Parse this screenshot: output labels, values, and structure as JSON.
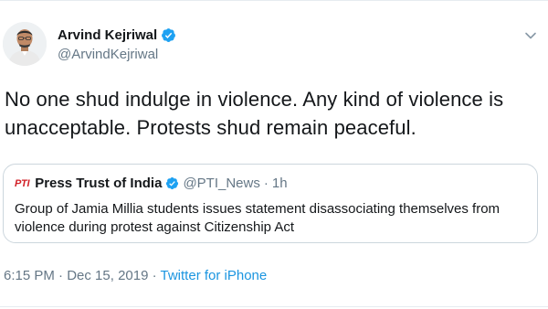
{
  "tweet": {
    "author": {
      "display_name": "Arvind Kejriwal",
      "handle": "@ArvindKejriwal",
      "verified": true
    },
    "text": "No one shud indulge in violence. Any kind of violence is unacceptable. Protests shud remain peaceful.",
    "quoted": {
      "logo_text": "PTI",
      "display_name": "Press Trust of India",
      "handle": "@PTI_News",
      "separator": "·",
      "time": "1h",
      "text": "Group of Jamia Millia students issues statement disassociating themselves from violence during protest against Citizenship Act"
    },
    "time": "6:15 PM",
    "separator1": " · ",
    "date": "Dec 15, 2019",
    "separator2": " · ",
    "source": "Twitter for iPhone"
  },
  "colors": {
    "accent": "#1b95e0",
    "verified_badge": "#1da1f2",
    "secondary_text": "#657786",
    "border": "#ccd6dd",
    "pti_red": "#d21f26"
  },
  "icons": {
    "menu": "chevron-down-icon",
    "badge": "verified-badge-icon"
  }
}
